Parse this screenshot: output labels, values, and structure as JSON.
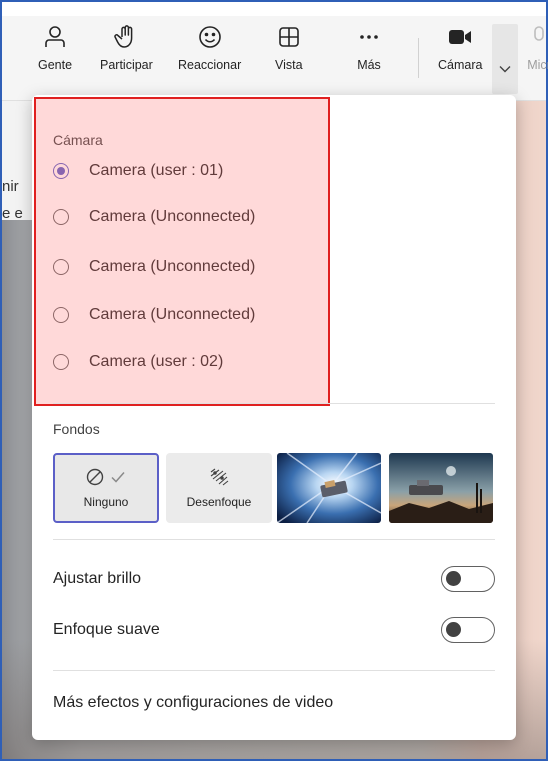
{
  "toolbar": {
    "people_label": "Gente",
    "raise_label": "Participar",
    "react_label": "Reaccionar",
    "view_label": "Vista",
    "more_label": "Más",
    "camera_label": "Cámara",
    "mic_label": "Micr"
  },
  "background_text": {
    "line1": "nir",
    "line2": "e e"
  },
  "camera_section": {
    "title": "Cámara",
    "options": [
      {
        "label": "Camera (user : 01)",
        "selected": true
      },
      {
        "label": "Camera (Unconnected)",
        "selected": false
      },
      {
        "label": "Camera (Unconnected)",
        "selected": false
      },
      {
        "label": "Camera (Unconnected)",
        "selected": false
      },
      {
        "label": "Camera (user : 02)",
        "selected": false
      }
    ]
  },
  "backgrounds": {
    "title": "Fondos",
    "none_label": "Ninguno",
    "blur_label": "Desenfoque"
  },
  "settings": {
    "brightness_label": "Ajustar brillo",
    "brightness_on": false,
    "soft_focus_label": "Enfoque suave",
    "soft_focus_on": false
  },
  "more_effects_label": "Más efectos y configuraciones de video",
  "colors": {
    "accent": "#5b5fc7",
    "highlight_border": "#e02020"
  }
}
